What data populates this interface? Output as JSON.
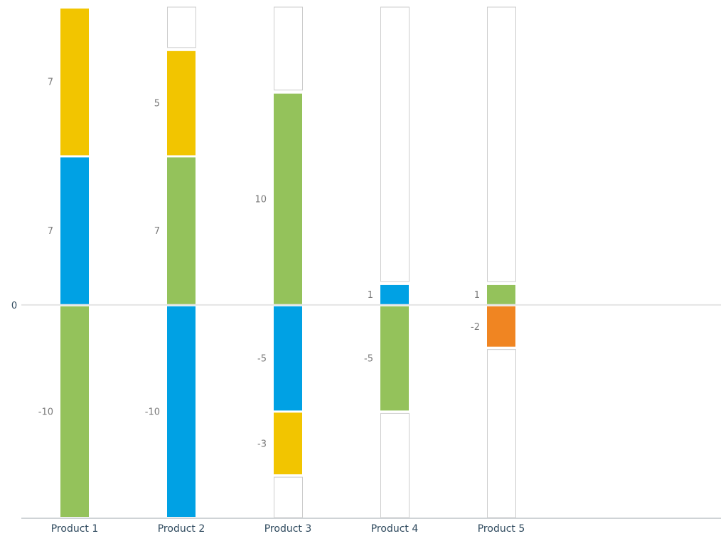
{
  "chart_data": {
    "type": "bar",
    "stacked": true,
    "title": "",
    "xlabel": "",
    "ylabel": "",
    "ylim": [
      -10,
      14
    ],
    "zero_label": "0",
    "categories": [
      "Product 1",
      "Product 2",
      "Product 3",
      "Product 4",
      "Product 5"
    ],
    "stacks": [
      {
        "category": "Product 1",
        "positive": [
          {
            "value": 7,
            "color": "#00a1e4"
          },
          {
            "value": 7,
            "color": "#f2c500"
          }
        ],
        "negative": [
          {
            "value": -10,
            "color": "#94c25b"
          }
        ]
      },
      {
        "category": "Product 2",
        "positive": [
          {
            "value": 7,
            "color": "#94c25b"
          },
          {
            "value": 5,
            "color": "#f2c500"
          }
        ],
        "negative": [
          {
            "value": -10,
            "color": "#00a1e4"
          }
        ]
      },
      {
        "category": "Product 3",
        "positive": [
          {
            "value": 10,
            "color": "#94c25b"
          }
        ],
        "negative": [
          {
            "value": -5,
            "color": "#00a1e4"
          },
          {
            "value": -3,
            "color": "#f2c500"
          }
        ]
      },
      {
        "category": "Product 4",
        "positive": [
          {
            "value": 1,
            "color": "#00a1e4"
          }
        ],
        "negative": [
          {
            "value": -5,
            "color": "#94c25b"
          }
        ]
      },
      {
        "category": "Product 5",
        "positive": [
          {
            "value": 1,
            "color": "#94c25b"
          }
        ],
        "negative": [
          {
            "value": -2,
            "color": "#f08522"
          }
        ]
      }
    ],
    "remainder_style": {
      "fill": "#ffffff",
      "stroke": "#cccccc"
    },
    "grid": false,
    "legend": "none"
  }
}
